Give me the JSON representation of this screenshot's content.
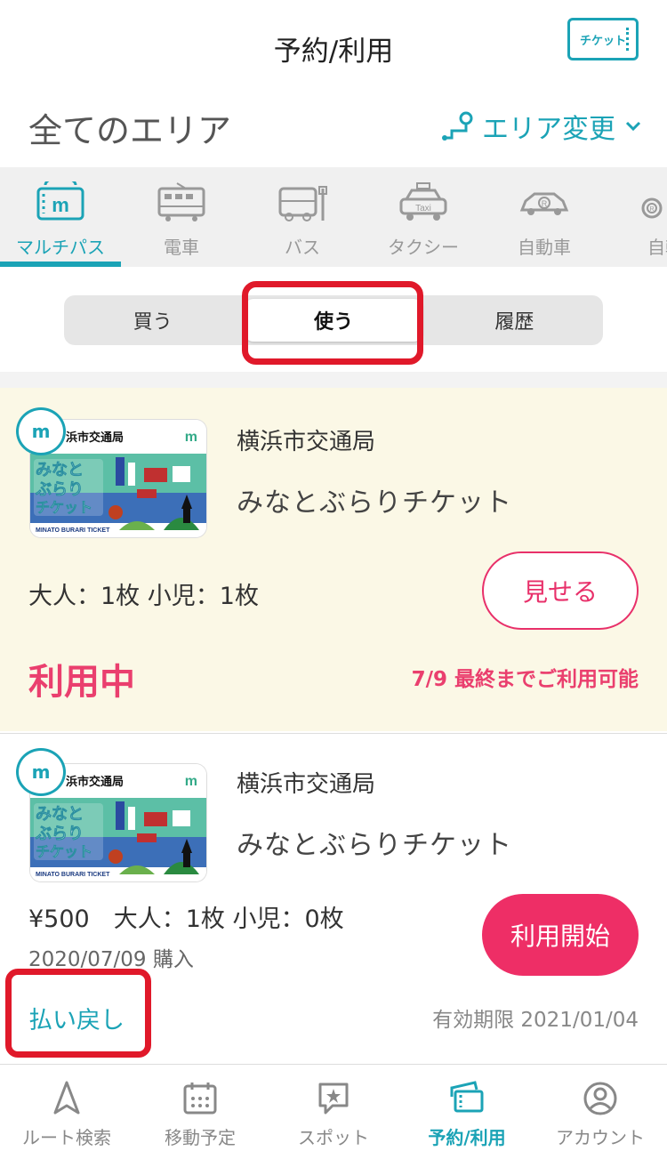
{
  "header": {
    "title": "予約/利用",
    "ticket_button_label": "チケット"
  },
  "area": {
    "title": "全てのエリア",
    "change_label": "エリア変更"
  },
  "mode_tabs": [
    {
      "label": "マルチパス",
      "icon": "multipass-icon",
      "active": true
    },
    {
      "label": "電車",
      "icon": "train-icon"
    },
    {
      "label": "バス",
      "icon": "bus-icon"
    },
    {
      "label": "タクシー",
      "icon": "taxi-icon"
    },
    {
      "label": "自動車",
      "icon": "car-icon"
    },
    {
      "label": "自転",
      "icon": "bicycle-icon"
    }
  ],
  "segments": {
    "buy": "買う",
    "use": "使う",
    "history": "履歴",
    "active": "use"
  },
  "tickets": [
    {
      "operator": "横浜市交通局",
      "name": "みなとぶらりチケット",
      "quantity": "大人：1枚 小児：1枚",
      "action_label": "見せる",
      "status": "利用中",
      "availability": "7/9 最終までご利用可能"
    },
    {
      "operator": "横浜市交通局",
      "name": "みなとぶらりチケット",
      "quantity": "¥500　大人：1枚 小児：0枚",
      "purchase_date": "2020/07/09 購入",
      "action_label": "利用開始",
      "refund_label": "払い戻し",
      "expiry": "有効期限 2021/01/04"
    }
  ],
  "thumbnail": {
    "operator_label": "浜市交通局",
    "lines": [
      "みなと",
      "ぶらり",
      "チケット"
    ],
    "caption": "MINATO BURARI TICKET"
  },
  "bottom_nav": [
    {
      "label": "ルート検索",
      "icon": "route-search-icon"
    },
    {
      "label": "移動予定",
      "icon": "calendar-icon"
    },
    {
      "label": "スポット",
      "icon": "spot-icon"
    },
    {
      "label": "予約/利用",
      "icon": "ticket-icon",
      "active": true
    },
    {
      "label": "アカウント",
      "icon": "account-icon"
    }
  ],
  "colors": {
    "accent": "#1ba3b6",
    "pink": "#ea3f6e",
    "button_pink": "#ee2e66",
    "highlight_red": "#e0192a",
    "card_active_bg": "#fbf8e6"
  }
}
